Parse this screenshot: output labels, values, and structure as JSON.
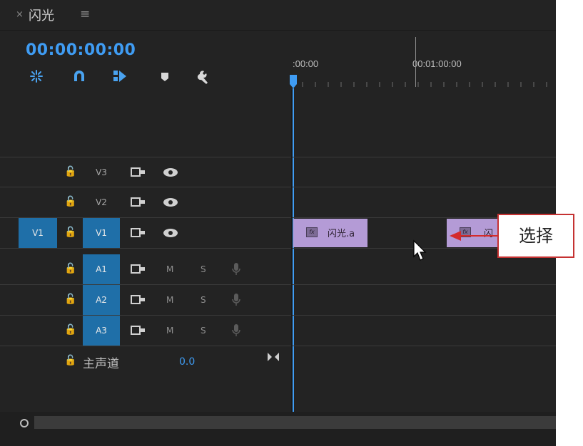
{
  "tab": {
    "close": "×",
    "title": "闪光",
    "menu": "≡"
  },
  "timecode": "00:00:00:00",
  "toolbar": [
    {
      "name": "snap-in-sequence-icon"
    },
    {
      "name": "magnet-snap-icon"
    },
    {
      "name": "linked-selection-icon"
    },
    {
      "name": "add-marker-icon"
    },
    {
      "name": "wrench-settings-icon"
    }
  ],
  "ruler": {
    "start": ":00:00",
    "mark": "00:01:00:00"
  },
  "tracks": {
    "v3": {
      "label": "V3"
    },
    "v2": {
      "label": "V2"
    },
    "v1": {
      "source": "V1",
      "label": "V1"
    },
    "a1": {
      "label": "A1",
      "m": "M",
      "s": "S"
    },
    "a2": {
      "label": "A2",
      "m": "M",
      "s": "S"
    },
    "a3": {
      "label": "A3",
      "m": "M",
      "s": "S"
    }
  },
  "master": {
    "label": "主声道",
    "value": "0.0"
  },
  "clips": [
    {
      "name": "闪光.a",
      "fx": "fx"
    },
    {
      "name": "闪",
      "fx": "fx"
    }
  ],
  "callout": {
    "text": "选择"
  },
  "colors": {
    "accent": "#3f9cf3",
    "track_active": "#1f6fa8",
    "clip": "#b49bd6",
    "callout_border": "#c53232"
  }
}
